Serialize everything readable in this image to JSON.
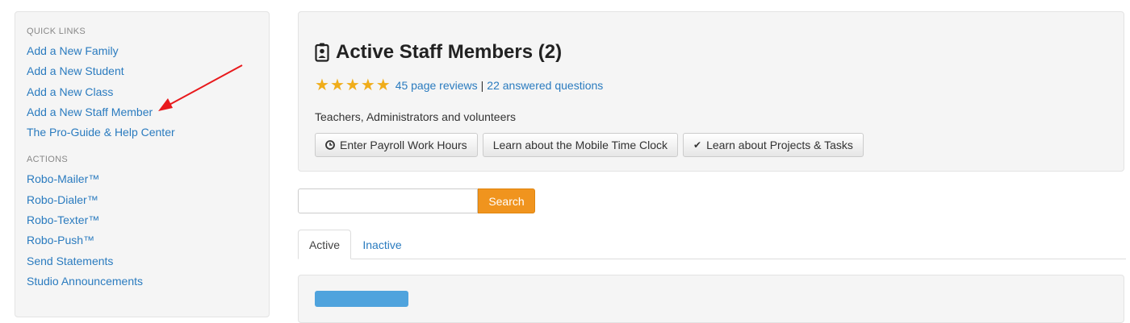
{
  "sidebar": {
    "quick_links_title": "QUICK LINKS",
    "quick_links": [
      "Add a New Family",
      "Add a New Student",
      "Add a New Class",
      "Add a New Staff Member",
      "The Pro-Guide & Help Center"
    ],
    "actions_title": "ACTIONS",
    "actions": [
      "Robo-Mailer™",
      "Robo-Dialer™",
      "Robo-Texter™",
      "Robo-Push™",
      "Send Statements",
      "Studio Announcements"
    ]
  },
  "header": {
    "title": "Active Staff Members (2)",
    "rating_stars": 5,
    "reviews_link": "45 page reviews",
    "separator": "|",
    "questions_link": "22 answered questions",
    "subtitle": "Teachers, Administrators and volunteers",
    "buttons": [
      {
        "label": "Enter Payroll Work Hours",
        "icon": "clock-icon"
      },
      {
        "label": "Learn about the Mobile Time Clock",
        "icon": ""
      },
      {
        "label": "Learn about Projects & Tasks",
        "icon": "checkmark-icon"
      }
    ]
  },
  "search": {
    "value": "",
    "button_label": "Search"
  },
  "tabs": [
    {
      "label": "Active",
      "active": true
    },
    {
      "label": "Inactive",
      "active": false
    }
  ],
  "colors": {
    "link": "#2a7bbf",
    "star": "#f0ad1a",
    "search_button": "#f0941e",
    "annotation_arrow": "#e8191c"
  }
}
